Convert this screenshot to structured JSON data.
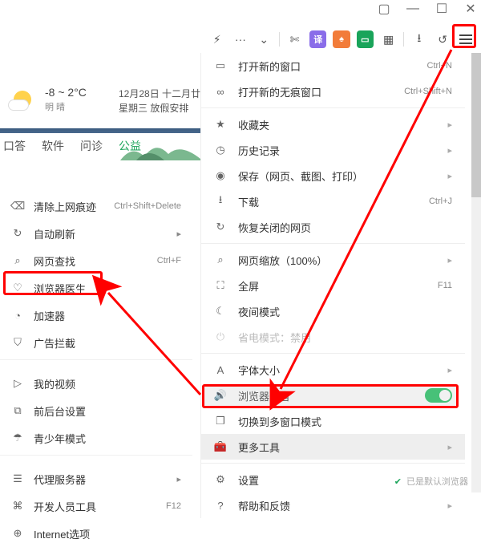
{
  "window_controls": {
    "ext": "▢",
    "min": "—",
    "max": "☐",
    "close": "✕"
  },
  "toolbar": {
    "bolt": "⚡",
    "dots": "···",
    "chevdown": "⌄",
    "cut": "✂",
    "translate_label": "译",
    "game_label": "🎮",
    "book_label": "▣",
    "grid_label": "▦",
    "download": "⭳",
    "undo": "↺"
  },
  "weather": {
    "temp": "-8 ~ 2°C",
    "cond": "明 晴"
  },
  "date": {
    "line1": "12月28日 十二月廿",
    "line2": "星期三   放假安排"
  },
  "tabs": {
    "da": "口答",
    "ruanjian": "软件",
    "wenzhen": "问诊",
    "gongyi": "公益"
  },
  "left_menu": {
    "clear": "清除上网痕迹",
    "clear_sc": "Ctrl+Shift+Delete",
    "refresh": "自动刷新",
    "find": "网页查找",
    "find_sc": "Ctrl+F",
    "doctor": "浏览器医生",
    "accel": "加速器",
    "adblock": "广告拦截",
    "video": "我的视频",
    "fgbg": "前后台设置",
    "youth": "青少年模式",
    "proxy": "代理服务器",
    "dev": "开发人员工具",
    "dev_sc": "F12",
    "inet": "Internet选项"
  },
  "main_menu": {
    "newwin": "打开新的窗口",
    "newwin_sc": "Ctrl+N",
    "incog": "打开新的无痕窗口",
    "incog_sc": "Ctrl+Shift+N",
    "fav": "收藏夹",
    "history": "历史记录",
    "save": "保存（网页、截图、打印）",
    "download": "下载",
    "download_sc": "Ctrl+J",
    "restore": "恢复关闭的网页",
    "zoom": "网页缩放（100%）",
    "fullscreen": "全屏",
    "fullscreen_sc": "F11",
    "night": "夜间模式",
    "power": "省电模式：禁用",
    "fontsize": "字体大小",
    "sound": "浏览器声音",
    "multiwin": "切换到多窗口模式",
    "moretools": "更多工具",
    "settings": "设置",
    "help": "帮助和反馈"
  },
  "footer": {
    "default_browser": "已是默认浏览器"
  }
}
